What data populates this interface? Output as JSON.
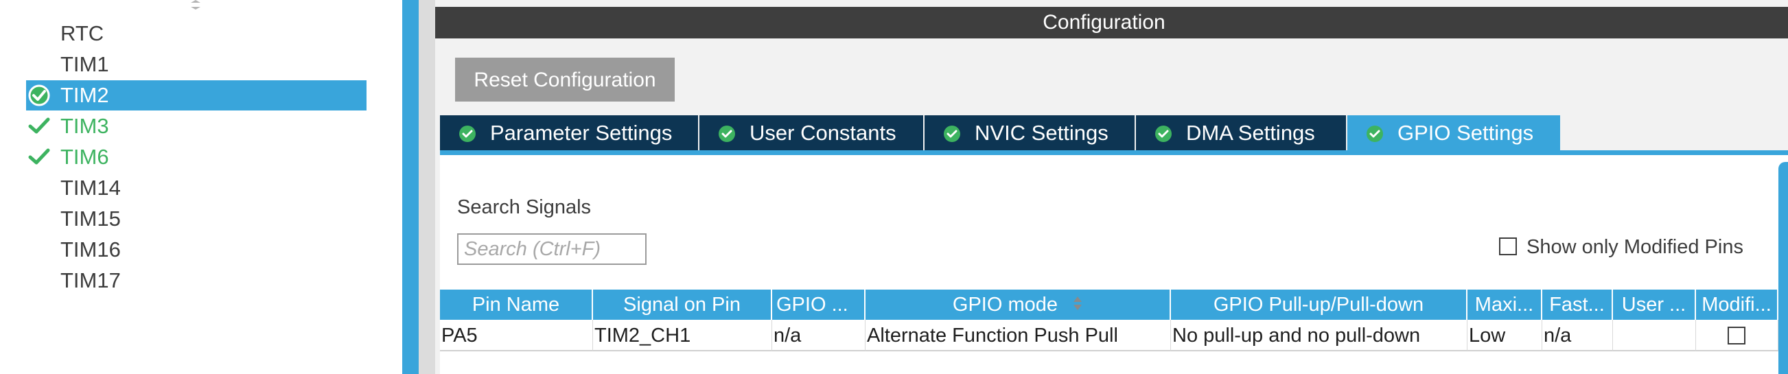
{
  "tree": {
    "items": [
      {
        "label": "RTC",
        "state": "none"
      },
      {
        "label": "TIM1",
        "state": "none"
      },
      {
        "label": "TIM2",
        "state": "selected"
      },
      {
        "label": "TIM3",
        "state": "enabled"
      },
      {
        "label": "TIM6",
        "state": "enabled"
      },
      {
        "label": "TIM14",
        "state": "none"
      },
      {
        "label": "TIM15",
        "state": "none"
      },
      {
        "label": "TIM16",
        "state": "none"
      },
      {
        "label": "TIM17",
        "state": "none"
      }
    ]
  },
  "config": {
    "title": "Configuration",
    "reset_label": "Reset Configuration",
    "tabs": [
      {
        "label": "Parameter Settings",
        "active": false
      },
      {
        "label": "User Constants",
        "active": false
      },
      {
        "label": "NVIC Settings",
        "active": false
      },
      {
        "label": "DMA Settings",
        "active": false
      },
      {
        "label": "GPIO Settings",
        "active": true
      }
    ],
    "search": {
      "label": "Search Signals",
      "placeholder": "Search (Ctrl+F)",
      "value": ""
    },
    "modified_toggle": {
      "label": "Show only Modified Pins",
      "checked": false
    },
    "table": {
      "columns": [
        "Pin Name",
        "Signal on Pin",
        "GPIO ...",
        "GPIO mode",
        "GPIO Pull-up/Pull-down",
        "Maxi...",
        "Fast...",
        "User ...",
        "Modifi..."
      ],
      "rows": [
        {
          "pin_name": "PA5",
          "signal": "TIM2_CH1",
          "gpio_output_level": "n/a",
          "gpio_mode": "Alternate Function Push Pull",
          "pull": "No pull-up and no pull-down",
          "max_speed": "Low",
          "fast_mode": "n/a",
          "user_label": "",
          "modified": false
        }
      ]
    }
  },
  "colors": {
    "accent": "#39a5db",
    "tab_dark": "#0d3553",
    "header_dark": "#3e3e3e",
    "enabled_green": "#3db360",
    "reset_gray": "#9b9b9b"
  },
  "icons": {
    "tree_selected": "check-circle-icon",
    "tree_enabled": "checkmark-icon",
    "tab": "check-circle-icon",
    "sort": "sort-icon",
    "tree_scroll": "scroll-up-icon"
  }
}
